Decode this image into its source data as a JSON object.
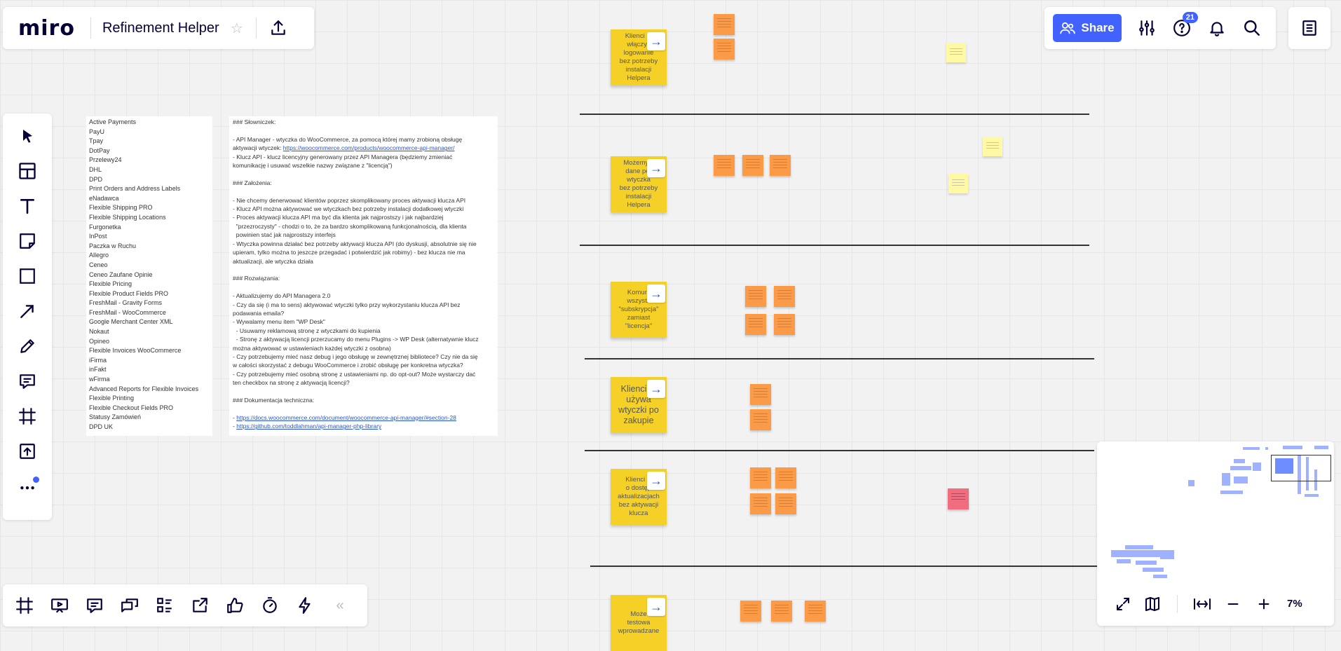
{
  "app": {
    "logo": "miro",
    "board_name": "Refinement Helper"
  },
  "top_right": {
    "share_label": "Share",
    "help_count": "21"
  },
  "integrations": [
    "Active Payments",
    "PayU",
    "Tpay",
    "DotPay",
    "Przelewy24",
    "DHL",
    "DPD",
    "Print Orders and Address Labels",
    "eNadawca",
    "Flexible Shipping PRO",
    "Flexible Shipping Locations",
    "Furgonetka",
    "InPost",
    "Paczka w Ruchu",
    "Allegro",
    "Ceneo",
    "Ceneo Zaufane Opinie",
    "Flexible Pricing",
    "Flexible Product Fields PRO",
    "FreshMail - Gravity Forms",
    "FreshMail - WooCommerce",
    "Google Merchant Center XML",
    "Nokaut",
    "Opineo",
    "Flexible Invoices WooCommerce",
    "iFirma",
    "inFakt",
    "wFirma",
    "Advanced Reports for Flexible Invoices",
    "Flexible Printing",
    "Flexible Checkout Fields PRO",
    "Statusy Zamówień",
    "DPD UK"
  ],
  "notes": {
    "lines": [
      "### Słowniczek:",
      "",
      "- API Manager - wtyczka do WooCommerce, za pomocą której mamy zrobioną obsługę",
      "aktywacji wtyczek: ",
      "- Klucz API - klucz licencyjny generowany przez API Managera (będziemy zmieniać",
      "komunikację i usuwać wszelkie nazwy związane z \"licencją\")",
      "",
      "### Założenia:",
      "",
      "- Nie chcemy denerwować klientów poprzez skomplikowany proces aktywacji klucza API",
      "- Klucz API można aktywować we wtyczkach bez potrzeby instalacji dodatkowej wtyczki",
      "- Proces aktywacji klucza API ma być dla klienta jak najprostszy i jak najbardziej",
      "  \"przezroczysty\" - chodzi o to, że za bardzo skomplikowaną funkcjonalnością, dla klienta",
      "  powinien stać jak najprostszy interfejs",
      "- Wtyczka powinna działać bez potrzeby aktywacji klucza API (do dyskusji, absolutnie się nie",
      "upieram, tylko można to jeszcze przegadać i potwierdzić jak robimy) - bez klucza nie ma",
      "aktualizacji, ale wtyczka działa",
      "",
      "### Rozwiązania:",
      "",
      "- Aktualizujemy do API Managera 2.0",
      "- Czy da się (i ma to sens) aktywować wtyczki tylko przy wykorzystaniu klucza API bez",
      "podawania emaila?",
      "- Wywalamy menu item \"WP Desk\"",
      "  - Usuwamy reklamową stronę z wtyczkami do kupienia",
      "  - Stronę z aktywacją licencji przerzucamy do menu Plugins -> WP Desk (alternatywnie klucz",
      "można aktywować w ustawieniach każdej wtyczki z osobna)",
      "- Czy potrzebujemy mieć nasz debug i jego obsługę w zewnętrznej bibliotece? Czy nie da się",
      "w całości skorzystać z debugu WooCommerce i zrobić obsługę per konkretna wtyczka?",
      "- Czy potrzebujemy mieć osobną stronę z ustawieniami np. do opt-out? Może wystarczy dać",
      "ten checkbox na stronę z aktywacją licencji?",
      "",
      "### Dokumentacja techniczna:",
      "",
      "- "
    ],
    "link_api_manager": "https://woocommerce.com/products/woocommerce-api-manager/",
    "doc_link_1": "https://docs.woocommerce.com/document/woocommerce-api-manager/#section-28",
    "doc_link_2": "https://github.com/toddlahman/api-manager-php-library"
  },
  "stickies": [
    {
      "text": "Klienci mogą włączyć logowanie bez potrzeby instalacji Helpera",
      "visible": "Klienci m\nwłączyć logowanie\nbez potrzeby\ninstalacji Helpera",
      "big": false
    },
    {
      "text": "Możemy zbierać dane per wtyczka bez potrzeby instalacji Helpera",
      "visible": "Możemy z\ndane per wtyczka\nbez potrzeby\ninstalacji Helpera",
      "big": false
    },
    {
      "text": "Komunikujemy wszystko jako \"subskrypcja\" zamiast \"licencja\"",
      "visible": "Komuni\nwszystk\n\"subskrypcja\"\nzamiast\n\"licencja\"",
      "big": false
    },
    {
      "text": "Klienci mogą używać wtyczki po zakupie",
      "visible": "Klienci m\nużywa\nwtyczki po\nzakupie",
      "big": true
    },
    {
      "text": "Klienci wiedzą o dostępnych aktualizacjach bez aktywacji klucza",
      "visible": "Klienci w\no dostęp\naktualizacjach\nbez aktywacji\nklucza",
      "big": false
    },
    {
      "text": "Możemy testować wprowadzane zmiany",
      "visible": "Może\ntestowa\nwprowadzane",
      "big": false
    }
  ],
  "minimap": {
    "zoom_level": "7%"
  }
}
